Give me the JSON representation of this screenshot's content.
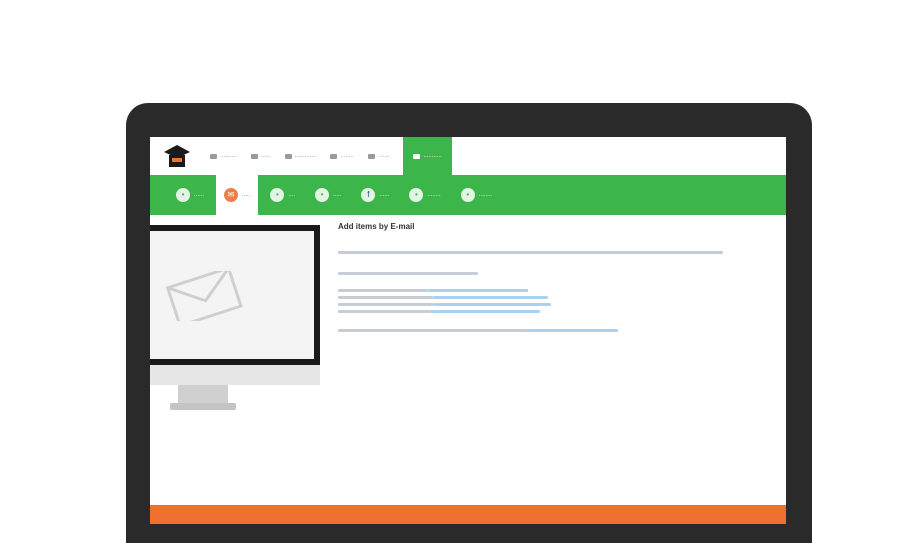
{
  "app": {
    "brand_color": "#3cb54a",
    "accent_color": "#f07030"
  },
  "top_nav": {
    "items": [
      {
        "label": "..........",
        "icon": "home-icon"
      },
      {
        "label": "......",
        "icon": "info-icon"
      },
      {
        "label": ".............",
        "icon": "people-icon"
      },
      {
        "label": "........",
        "icon": "book-icon"
      },
      {
        "label": ".......",
        "icon": "mail-icon"
      },
      {
        "label": "...........",
        "icon": "person-icon"
      }
    ]
  },
  "tabs": [
    {
      "label": "......",
      "icon": "circle-icon"
    },
    {
      "label": ".....",
      "icon": "mail-icon"
    },
    {
      "label": "....",
      "icon": "circle-icon"
    },
    {
      "label": ".....",
      "icon": "circle-icon"
    },
    {
      "label": "......",
      "icon": "facebook-icon"
    },
    {
      "label": "........",
      "icon": "circle-icon"
    },
    {
      "label": "........",
      "icon": "circle-icon"
    }
  ],
  "content": {
    "title": "Add items by E-mail"
  }
}
